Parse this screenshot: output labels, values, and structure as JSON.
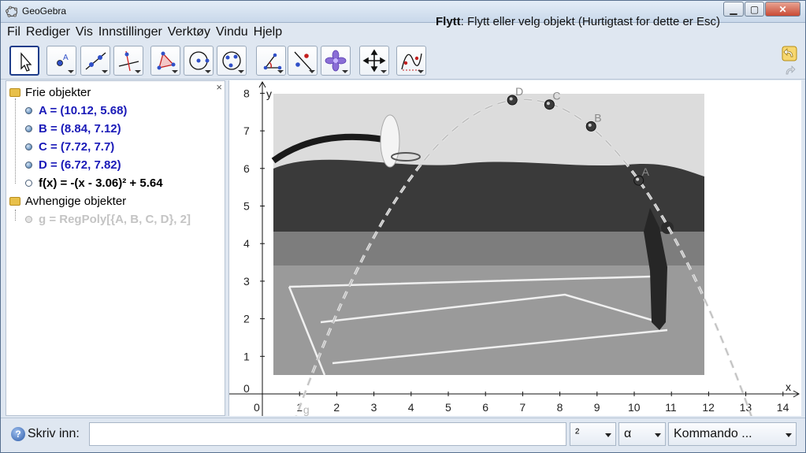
{
  "window": {
    "title": "GeoGebra",
    "controls": [
      "▁",
      "▢",
      "✕"
    ]
  },
  "menu": [
    "Fil",
    "Rediger",
    "Vis",
    "Innstillinger",
    "Verktøy",
    "Vindu",
    "Hjelp"
  ],
  "toolbar": {
    "tools": [
      "move-tool",
      "point-tool",
      "line-tool",
      "perpendicular-tool",
      "polygon-tool",
      "circle-tool",
      "ellipse-tool",
      "angle-tool",
      "reflect-tool",
      "slider-tool",
      "move-view-tool",
      "function-inspector-tool"
    ],
    "help_title": "Flytt",
    "help_text": ": Flytt eller velg objekt (Hurtigtast for dette er Esc)"
  },
  "algebra": {
    "free_header": "Frie objekter",
    "free_objects": [
      {
        "text": "A = (10.12, 5.68)",
        "color": "#1a1ab8",
        "bold": true
      },
      {
        "text": "B = (8.84, 7.12)",
        "color": "#1a1ab8",
        "bold": true
      },
      {
        "text": "C = (7.72, 7.7)",
        "color": "#1a1ab8",
        "bold": true
      },
      {
        "text": "D = (6.72, 7.82)",
        "color": "#1a1ab8",
        "bold": true
      },
      {
        "text": "f(x) = -(x - 3.06)² + 5.64",
        "color": "#000000",
        "bold": true
      }
    ],
    "dependent_header": "Avhengige objekter",
    "dependent_objects": [
      {
        "text": "g = RegPoly[{A, B, C, D}, 2]",
        "color": "#c4c4c4",
        "bold": true
      }
    ]
  },
  "graphics": {
    "x_axis_label": "x",
    "y_axis_label": "y",
    "x_ticks": [
      "0",
      "1",
      "2",
      "3",
      "4",
      "5",
      "6",
      "7",
      "8",
      "9",
      "10",
      "11",
      "12",
      "13",
      "14"
    ],
    "y_ticks": [
      "0",
      "1",
      "2",
      "3",
      "4",
      "5",
      "6",
      "7",
      "8"
    ],
    "points": [
      {
        "name": "A",
        "x": 10.12,
        "y": 5.68
      },
      {
        "name": "B",
        "x": 8.84,
        "y": 7.12
      },
      {
        "name": "C",
        "x": 7.72,
        "y": 7.7
      },
      {
        "name": "D",
        "x": 6.72,
        "y": 7.82
      }
    ],
    "curve_label": "g",
    "background_image": "basketball-court-photo"
  },
  "input_bar": {
    "label": "Skriv inn:",
    "value": "",
    "combo_power": "²",
    "combo_greek": "α",
    "combo_command": "Kommando ..."
  }
}
